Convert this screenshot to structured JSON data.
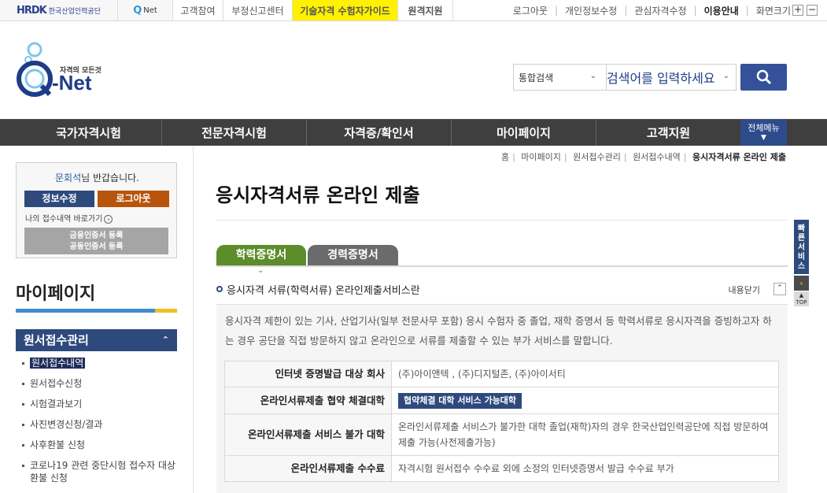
{
  "util": {
    "brand1_mark": "HRDK",
    "brand1_sub": "한국산업인력공단",
    "brand2_q": "Q",
    "brand2_net": "Net",
    "tab_customer": "고객참여",
    "tab_report": "부정신고센터",
    "tab_guide": "기술자격 수험자가이드",
    "tab_remote": "원격지원",
    "link_logout": "로그아웃",
    "link_profile": "개인정보수정",
    "link_interest": "관심자격수정",
    "link_usage": "이용안내",
    "link_screen": "화면크기",
    "zoom_in": "+",
    "zoom_out": "−"
  },
  "logo": {
    "tagline": "자격의 모든것",
    "name": "Q-Net"
  },
  "search": {
    "scope": "통합검색",
    "placeholder": "검색어를 입력하세요"
  },
  "nav": [
    "국가자격시험",
    "전문자격시험",
    "자격증/확인서",
    "마이페이지",
    "고객지원"
  ],
  "nav_all": "전체메뉴",
  "sidebar": {
    "user_name": "문회석",
    "greeting": "님 반갑습니다.",
    "edit_btn": "정보수정",
    "logout_btn": "로그아웃",
    "goto": "나의 접수내역 바로가기",
    "cert_line1": "금융인증서 등록",
    "cert_line2": "공동인증서 등록",
    "title": "마이페이지",
    "menu_head": "원서접수관리",
    "items": [
      "원서접수내역",
      "원서접수신청",
      "시험결과보기",
      "사진변경신청/결과",
      "사후환불 신청",
      "코로나19 관련 중단시험 접수자 대상 환불 신청"
    ]
  },
  "breadcrumb": [
    "홈",
    "마이페이지",
    "원서접수관리",
    "원서접수내역",
    "응시자격서류 온라인 제출"
  ],
  "page_title": "응시자격서류 온라인 제출",
  "tabs": [
    "학력증명서",
    "경력증명서"
  ],
  "section": {
    "title": "응시자격 서류(학력서류) 온라인제출서비스란",
    "close_label": "내용닫기",
    "desc": "응시자격 제한이 있는 기사, 산업기사(일부 전문사무 포함) 응시 수험자 중 졸업, 재학 증명서 등 학력서류로 응시자격을 증빙하고자 하는 경우 공단을 직접 방문하지 않고 온라인으로 서류를 제출할 수 있는 부가 서비스를 말합니다."
  },
  "table": [
    {
      "h": "인터넷 증명발급 대상 회사",
      "v": "(주)아이앤텍 , (주)디지털존, (주)아이서티"
    },
    {
      "h": "온라인서류제출 협약 체결대학",
      "v": "협약체결 대학 서비스 가능대학"
    },
    {
      "h": "온라인서류제출 서비스 불가 대학",
      "v": "온라인서류제출 서비스가 불가한 대학 졸업(재학)자의 경우 한국산업인력공단에 직접 방문하여 제출 가능(사전제출가능)"
    },
    {
      "h": "온라인서류제출 수수료",
      "v": "자격시험 원서접수 수수료 외에 소정의 인터넷증명서 발급 수수료 부가"
    }
  ],
  "quick": {
    "label": "빠른서비스",
    "top": "TOP"
  }
}
